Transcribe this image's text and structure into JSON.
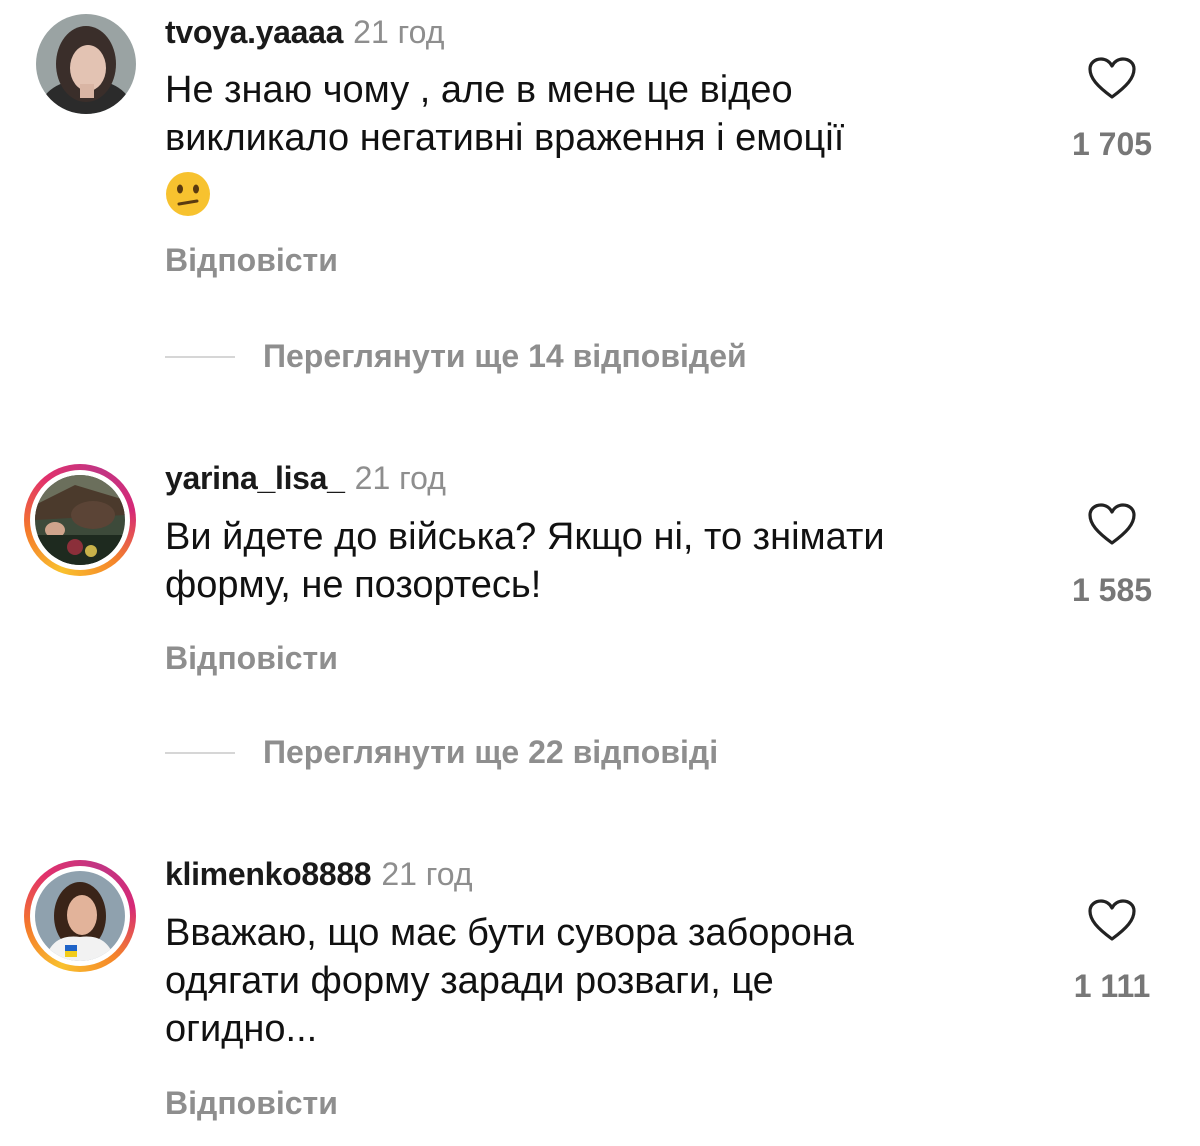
{
  "comments": [
    {
      "username": "tvoya.yaaaa",
      "time": "21 год",
      "text_lines": [
        "Не знаю чому , але в мене це відео",
        "викликало негативні враження і емоції"
      ],
      "emoji": "😕",
      "likes": "1 705",
      "reply_label": "Відповісти",
      "view_replies": "Переглянути ще 14 відповідей",
      "avatar_ring": false
    },
    {
      "username": "yarina_lisa_",
      "time": "21 год",
      "text_lines": [
        "Ви йдете до війська? Якщо ні, то знімати",
        "форму, не позортесь!"
      ],
      "likes": "1 585",
      "reply_label": "Відповісти",
      "view_replies": "Переглянути ще 22 відповіді",
      "avatar_ring": true
    },
    {
      "username": "klimenko8888",
      "time": "21 год",
      "text_lines": [
        "Вважаю, що має бути сувора заборона",
        "одягати форму заради розваги, це",
        "огидно..."
      ],
      "likes": "1 111",
      "reply_label": "Відповісти",
      "avatar_ring": true
    }
  ],
  "colors": {
    "text": "#111111",
    "muted": "#8e8e8e",
    "like_count": "#777777",
    "story_ring": [
      "#f9c12e",
      "#e1306c",
      "#c13584"
    ]
  }
}
